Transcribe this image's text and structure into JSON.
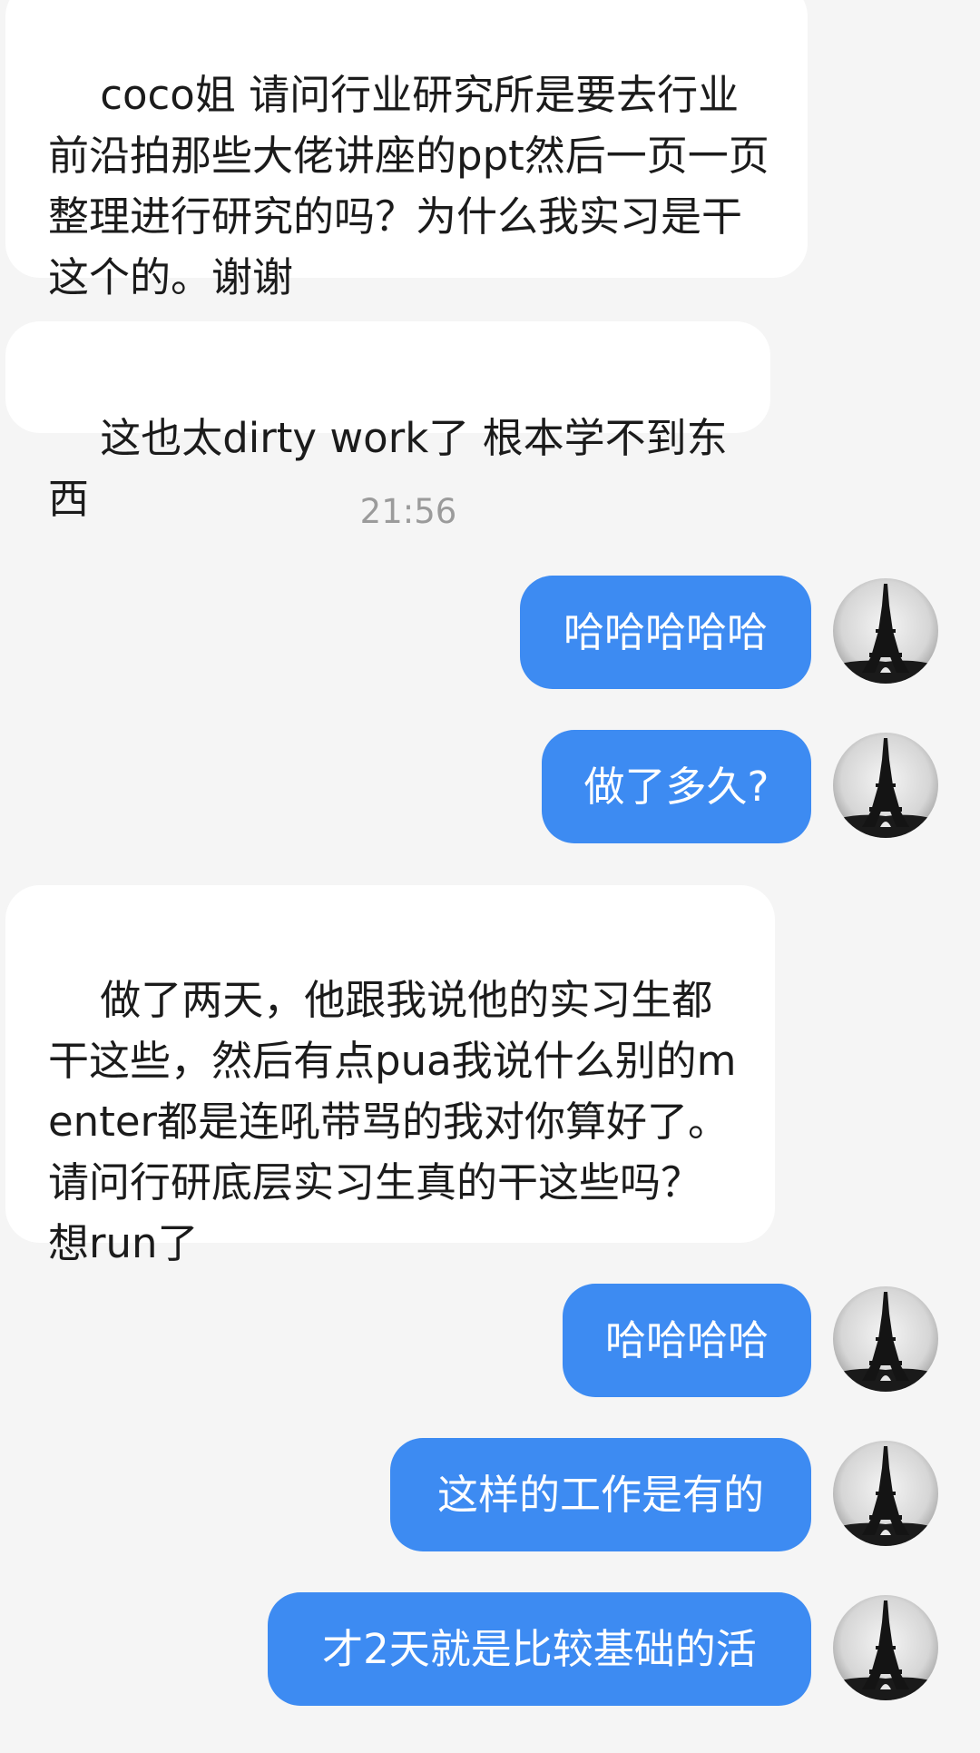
{
  "messages": [
    {
      "side": "in",
      "text": "coco姐 请问行业研究所是要去行业前沿拍那些大佬讲座的ppt然后一页一页整理进行研究的吗？为什么我实习是干这个的。谢谢"
    },
    {
      "side": "in",
      "text": "这也太dirty work了 根本学不到东西"
    },
    {
      "side": "time",
      "text": "21:56"
    },
    {
      "side": "out",
      "text": "哈哈哈哈哈"
    },
    {
      "side": "out",
      "text": "做了多久?"
    },
    {
      "side": "in",
      "text": "做了两天，他跟我说他的实习生都干这些，然后有点pua我说什么别的menter都是连吼带骂的我对你算好了。请问行研底层实习生真的干这些吗？想run了"
    },
    {
      "side": "out",
      "text": "哈哈哈哈"
    },
    {
      "side": "out",
      "text": "这样的工作是有的"
    },
    {
      "side": "out",
      "text": "才2天就是比较基础的活"
    }
  ],
  "avatar_icon": "eiffel-tower-avatar-icon",
  "colors": {
    "background": "#f5f5f5",
    "incoming_bubble": "#ffffff",
    "outgoing_bubble": "#3d8bf2",
    "timestamp_text": "#9b9b9b"
  }
}
